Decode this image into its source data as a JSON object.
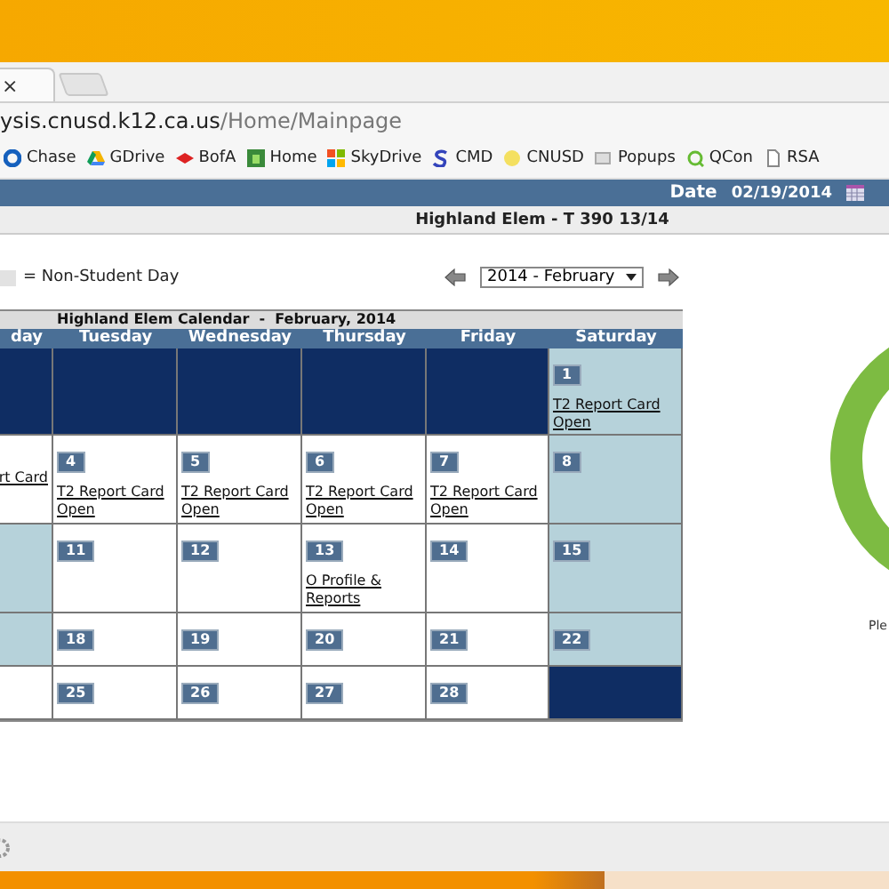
{
  "browser": {
    "tab_close": "×",
    "address_host": "ysis.cnusd.k12.ca.us",
    "address_path": "/Home/Mainpage",
    "bookmarks": [
      {
        "label": "Chase"
      },
      {
        "label": "GDrive"
      },
      {
        "label": "BofA"
      },
      {
        "label": "Home"
      },
      {
        "label": "SkyDrive"
      },
      {
        "label": "CMD"
      },
      {
        "label": "CNUSD"
      },
      {
        "label": "Popups"
      },
      {
        "label": "QCon"
      },
      {
        "label": "RSA"
      }
    ]
  },
  "header": {
    "date_label": "Date",
    "date_value": "02/19/2014"
  },
  "title": "Highland Elem - T 390 13/14",
  "legend": {
    "text": "= Non-Student Day"
  },
  "month_select": {
    "value": "2014 - February"
  },
  "calendar": {
    "title": "Highland Elem Calendar  -  February, 2014",
    "days": [
      "day",
      "Tuesday",
      "Wednesday",
      "Thursday",
      "Friday",
      "Saturday"
    ],
    "weeks": [
      [
        {
          "kind": "outside"
        },
        {
          "kind": "outside"
        },
        {
          "kind": "outside"
        },
        {
          "kind": "outside"
        },
        {
          "kind": "outside"
        },
        {
          "kind": "nonstudent",
          "number": "1",
          "events": [
            "T2 Report Card Open"
          ]
        }
      ],
      [
        {
          "kind": "school",
          "events": [
            "rt Card"
          ]
        },
        {
          "kind": "school",
          "number": "4",
          "events": [
            "T2 Report Card Open"
          ]
        },
        {
          "kind": "school",
          "number": "5",
          "events": [
            "T2 Report Card Open"
          ]
        },
        {
          "kind": "school",
          "number": "6",
          "events": [
            "T2 Report Card Open"
          ]
        },
        {
          "kind": "school",
          "number": "7",
          "events": [
            "T2 Report Card Open"
          ]
        },
        {
          "kind": "nonstudent",
          "number": "8"
        }
      ],
      [
        {
          "kind": "nonstudent"
        },
        {
          "kind": "school",
          "number": "11"
        },
        {
          "kind": "school",
          "number": "12"
        },
        {
          "kind": "school",
          "number": "13",
          "events": [
            "O Profile & Reports"
          ]
        },
        {
          "kind": "school",
          "number": "14"
        },
        {
          "kind": "nonstudent",
          "number": "15"
        }
      ],
      [
        {
          "kind": "nonstudent"
        },
        {
          "kind": "school",
          "number": "18"
        },
        {
          "kind": "school",
          "number": "19"
        },
        {
          "kind": "school",
          "number": "20"
        },
        {
          "kind": "school",
          "number": "21"
        },
        {
          "kind": "nonstudent",
          "number": "22"
        }
      ],
      [
        {
          "kind": "school"
        },
        {
          "kind": "school",
          "number": "25"
        },
        {
          "kind": "school",
          "number": "26"
        },
        {
          "kind": "school",
          "number": "27"
        },
        {
          "kind": "school",
          "number": "28"
        },
        {
          "kind": "outside"
        }
      ]
    ]
  },
  "side": {
    "caption": "Ple"
  }
}
